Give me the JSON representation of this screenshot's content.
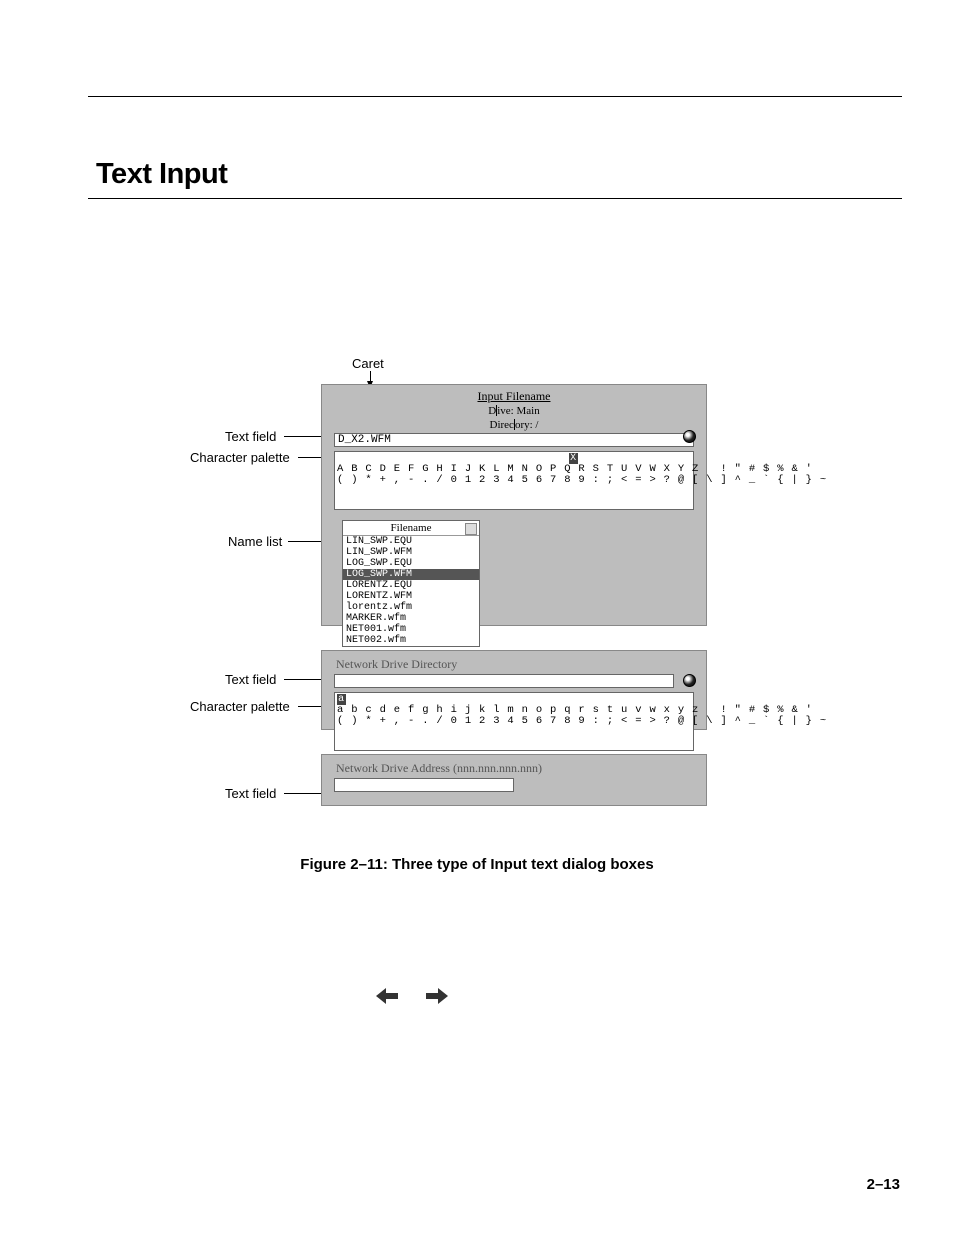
{
  "section_title": "Text Input",
  "caret_label": "Caret",
  "callouts": {
    "d1_text_field": "Text field",
    "d1_char_palette": "Character palette",
    "d1_name_list": "Name list",
    "d2_text_field": "Text field",
    "d2_char_palette": "Character palette",
    "d3_text_field": "Text field"
  },
  "dialog1": {
    "title": "Input Filename",
    "sub1_left": "D",
    "sub1_right": "ive: Main",
    "sub2_left": "Direc",
    "sub2_right": "ory: /",
    "text_field_value": "D_X2.WFM",
    "palette_row1": "A B C D E F G H I J K L M N O P Q R S T U V W X Y Z   ! \" # $ % & '",
    "palette_row2": "( ) * + , - . / 0 1 2 3 4 5 6 7 8 9 : ; < = > ? @ [ \\ ] ^ _ ` { | } ~",
    "palette_hl_char": "X",
    "filelist": {
      "header": "Filename",
      "items": [
        "LIN_SWP.EQU",
        "LIN_SWP.WFM",
        "LOG_SWP.EQU",
        "LOG_SWP.WFM",
        "LORENTZ.EQU",
        "LORENTZ.WFM",
        "lorentz.wfm",
        "MARKER.wfm",
        "NET001.wfm",
        "NET002.wfm"
      ],
      "selected_index": 3
    }
  },
  "dialog2": {
    "label": "Network Drive Directory",
    "text_field_value": "",
    "palette_row1": "a b c d e f g h i j k l m n o p q r s t u v w x y z   ! \" # $ % & '",
    "palette_row2": "( ) * + , - . / 0 1 2 3 4 5 6 7 8 9 : ; < = > ? @ [ \\ ] ^ _ ` { | } ~",
    "palette_hl_char": "a"
  },
  "dialog3": {
    "label": "Network Drive Address (nnn.nnn.nnn.nnn)",
    "text_field_value": ""
  },
  "figure_caption": "Figure 2–11: Three type of Input text dialog boxes",
  "page_number": "2–13"
}
